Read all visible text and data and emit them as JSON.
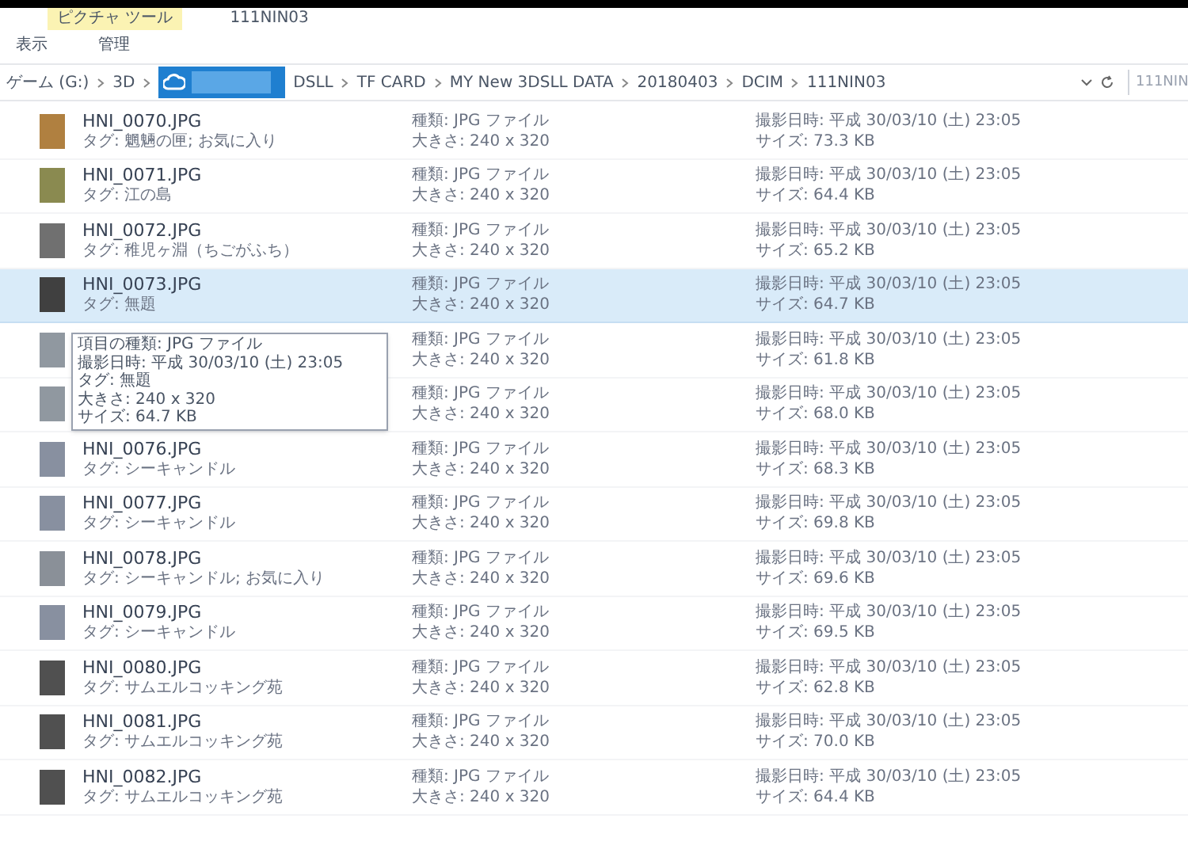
{
  "ribbon": {
    "context_tab": "ピクチャ ツール",
    "title": "111NIN03",
    "tabs": [
      {
        "label": "表示",
        "selected": false
      },
      {
        "label": "管理",
        "selected": false
      }
    ]
  },
  "address_bar": {
    "crumbs": [
      "ゲーム (G:)",
      "3D",
      "DSLL",
      "TF CARD",
      "MY New 3DSLL DATA",
      "20180403",
      "DCIM",
      "111NIN03"
    ],
    "search_placeholder": "111NIN"
  },
  "files": [
    {
      "name": "HNI_0070.JPG",
      "tag": "タグ: 魍魎の匣; お気に入り",
      "type": "種類: JPG ファイル",
      "dimensions": "大きさ: 240 x 320",
      "date": "撮影日時: 平成 30/03/10 (土) 23:05",
      "size": "サイズ: 73.3 KB",
      "selected": false
    },
    {
      "name": "HNI_0071.JPG",
      "tag": "タグ: 江の島",
      "type": "種類: JPG ファイル",
      "dimensions": "大きさ: 240 x 320",
      "date": "撮影日時: 平成 30/03/10 (土) 23:05",
      "size": "サイズ: 64.4 KB",
      "selected": false
    },
    {
      "name": "HNI_0072.JPG",
      "tag": "タグ: 稚児ヶ淵（ちごがふち）",
      "type": "種類: JPG ファイル",
      "dimensions": "大きさ: 240 x 320",
      "date": "撮影日時: 平成 30/03/10 (土) 23:05",
      "size": "サイズ: 65.2 KB",
      "selected": false
    },
    {
      "name": "HNI_0073.JPG",
      "tag": "タグ: 無題",
      "type": "種類: JPG ファイル",
      "dimensions": "大きさ: 240 x 320",
      "date": "撮影日時: 平成 30/03/10 (土) 23:05",
      "size": "サイズ: 64.7 KB",
      "selected": true
    },
    {
      "type": "種類: JPG ファイル",
      "dimensions": "大きさ: 240 x 320",
      "date": "撮影日時: 平成 30/03/10 (土) 23:05",
      "size": "サイズ: 61.8 KB",
      "selected": false
    },
    {
      "type": "種類: JPG ファイル",
      "dimensions": "大きさ: 240 x 320",
      "date": "撮影日時: 平成 30/03/10 (土) 23:05",
      "size": "サイズ: 68.0 KB",
      "selected": false
    },
    {
      "name": "HNI_0076.JPG",
      "tag": "タグ: シーキャンドル",
      "type": "種類: JPG ファイル",
      "dimensions": "大きさ: 240 x 320",
      "date": "撮影日時: 平成 30/03/10 (土) 23:05",
      "size": "サイズ: 68.3 KB",
      "selected": false
    },
    {
      "name": "HNI_0077.JPG",
      "tag": "タグ: シーキャンドル",
      "type": "種類: JPG ファイル",
      "dimensions": "大きさ: 240 x 320",
      "date": "撮影日時: 平成 30/03/10 (土) 23:05",
      "size": "サイズ: 69.8 KB",
      "selected": false
    },
    {
      "name": "HNI_0078.JPG",
      "tag": "タグ: シーキャンドル; お気に入り",
      "type": "種類: JPG ファイル",
      "dimensions": "大きさ: 240 x 320",
      "date": "撮影日時: 平成 30/03/10 (土) 23:05",
      "size": "サイズ: 69.6 KB",
      "selected": false
    },
    {
      "name": "HNI_0079.JPG",
      "tag": "タグ: シーキャンドル",
      "type": "種類: JPG ファイル",
      "dimensions": "大きさ: 240 x 320",
      "date": "撮影日時: 平成 30/03/10 (土) 23:05",
      "size": "サイズ: 69.5 KB",
      "selected": false
    },
    {
      "name": "HNI_0080.JPG",
      "tag": "タグ: サムエルコッキング苑",
      "type": "種類: JPG ファイル",
      "dimensions": "大きさ: 240 x 320",
      "date": "撮影日時: 平成 30/03/10 (土) 23:05",
      "size": "サイズ: 62.8 KB",
      "selected": false
    },
    {
      "name": "HNI_0081.JPG",
      "tag": "タグ: サムエルコッキング苑",
      "type": "種類: JPG ファイル",
      "dimensions": "大きさ: 240 x 320",
      "date": "撮影日時: 平成 30/03/10 (土) 23:05",
      "size": "サイズ: 70.0 KB",
      "selected": false
    },
    {
      "name": "HNI_0082.JPG",
      "tag": "タグ: サムエルコッキング苑",
      "type": "種類: JPG ファイル",
      "dimensions": "大きさ: 240 x 320",
      "date": "撮影日時: 平成 30/03/10 (土) 23:05",
      "size": "サイズ: 64.4 KB",
      "selected": false
    }
  ],
  "tooltip": [
    "項目の種類: JPG ファイル",
    "撮影日時: 平成 30/03/10 (土) 23:05",
    "タグ: 無題",
    "大きさ: 240 x 320",
    "サイズ: 64.7 KB"
  ]
}
